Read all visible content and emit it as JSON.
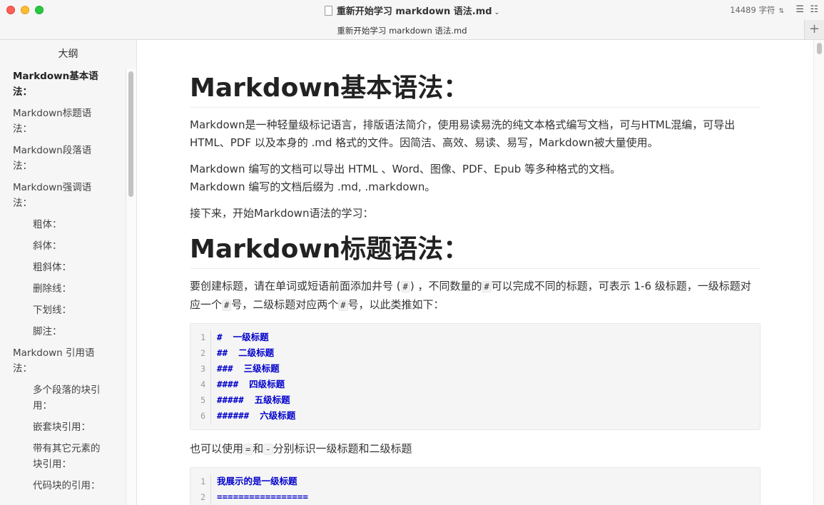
{
  "window": {
    "title": "重新开始学习 markdown 语法.md",
    "word_count": "14489 字符"
  },
  "tab": {
    "title": "重新开始学习 markdown 语法.md"
  },
  "sidebar": {
    "heading": "大纲",
    "items": [
      {
        "label": "Markdown基本语法：",
        "level": 1,
        "bold": true
      },
      {
        "label": "Markdown标题语法：",
        "level": 1
      },
      {
        "label": "Markdown段落语法：",
        "level": 1
      },
      {
        "label": "Markdown强调语法：",
        "level": 1
      },
      {
        "label": "粗体：",
        "level": 2
      },
      {
        "label": "斜体：",
        "level": 2
      },
      {
        "label": "粗斜体：",
        "level": 2
      },
      {
        "label": "删除线：",
        "level": 2
      },
      {
        "label": "下划线：",
        "level": 2
      },
      {
        "label": "脚注：",
        "level": 2
      },
      {
        "label": "Markdown 引用语法：",
        "level": 1
      },
      {
        "label": "多个段落的块引用：",
        "level": 2
      },
      {
        "label": "嵌套块引用：",
        "level": 2
      },
      {
        "label": "带有其它元素的块引用：",
        "level": 2
      },
      {
        "label": "代码块的引用：",
        "level": 2
      }
    ]
  },
  "content": {
    "h1_basic": "Markdown基本语法：",
    "p1": "Markdown是一种轻量级标记语言，排版语法简介，使用易读易洗的纯文本格式编写文档，可与HTML混编，可导出 HTML、PDF 以及本身的 .md 格式的文件。因简洁、高效、易读、易写，Markdown被大量使用。",
    "p2_line1": "Markdown 编写的文档可以导出 HTML 、Word、图像、PDF、Epub 等多种格式的文档。",
    "p2_line2": "Markdown 编写的文档后缀为 .md, .markdown。",
    "p3": "接下来，开始Markdown语法的学习：",
    "h1_heading": "Markdown标题语法：",
    "p4": {
      "t1": "要创建标题，请在单词或短语前面添加井号 (",
      "c1": "#",
      "t2": ") ，不同数量的",
      "c2": "#",
      "t3": "可以完成不同的标题，可表示 1-6 级标题，一级标题对应一个",
      "c3": "#",
      "t4": "号，二级标题对应两个",
      "c4": "#",
      "t5": "号，以此类推如下："
    },
    "code1": [
      {
        "n": "1",
        "text": "#  一级标题"
      },
      {
        "n": "2",
        "text": "##  二级标题"
      },
      {
        "n": "3",
        "text": "###  三级标题"
      },
      {
        "n": "4",
        "text": "####  四级标题"
      },
      {
        "n": "5",
        "text": "#####  五级标题"
      },
      {
        "n": "6",
        "text": "######  六级标题"
      }
    ],
    "p5": {
      "t1": "也可以使用",
      "c1": "=",
      "t2": "和",
      "c2": "-",
      "t3": "分别标识一级标题和二级标题"
    },
    "code2": [
      {
        "n": "1",
        "text": "我展示的是一级标题"
      },
      {
        "n": "2",
        "text": "================="
      }
    ]
  }
}
